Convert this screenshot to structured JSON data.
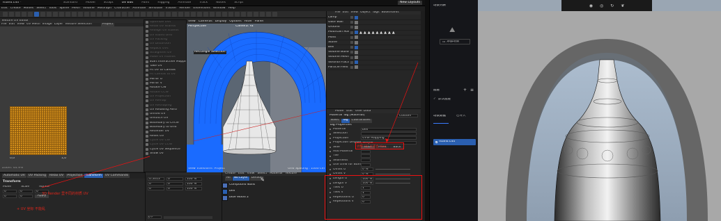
{
  "titlebar": {
    "file": "island.c4d *",
    "layouts": [
      "Standard",
      "Model",
      "Sculpt",
      "UV Edit",
      "Paint",
      "Rigging",
      "Animate",
      "Track",
      "Nodes",
      "Script"
    ],
    "new_layouts": "New Layouts"
  },
  "menubar": [
    "Edit",
    "Create",
    "Modes",
    "Select",
    "Tools",
    "Spline",
    "Mesh",
    "Volume",
    "MoGraph",
    "Character",
    "Animate",
    "Simulate",
    "Tracker",
    "Render",
    "Extensions",
    "Window",
    "Help"
  ],
  "uv_editor": {
    "title": "Texture UV Editor",
    "menus": [
      "File",
      "Edit",
      "View",
      "UV Mesh",
      "Image",
      "Layer",
      "Texture Selection"
    ],
    "project": "Project",
    "scale_label": "Zoom: 44.9%",
    "axis": [
      "0,0",
      "1,0"
    ]
  },
  "uv_menu": {
    "items": [
      "Optimize UVs",
      "Relax UV Islands",
      "Realign UV Islands",
      "UV Island Grid",
      "UV Packing",
      "UV Distortion",
      "Repack UVs",
      "Straighten UV",
      "Make UV Islands",
      "Start Interactive Mapping",
      "Take UV",
      "Fit UV to Canvas",
      "Fit Canvas to UV",
      "Mirror U",
      "Mirror V",
      "Rotate CW",
      "Rotate CCW",
      "UV Projection",
      "UV Remap",
      "UV Reshaping",
      "UV Relaxing Aero",
      "Unfold UV",
      "Unstitch UV",
      "Boundary to Circle",
      "Boundary to Grid",
      "Recenter UV",
      "Reset UV",
      "Cycle UV CW",
      "Cycle UV CCW",
      "Cycle UV Sequence",
      "Show UV"
    ],
    "dim_indices": [
      0,
      1,
      2,
      3,
      4,
      5,
      6,
      7,
      8,
      12,
      16,
      17,
      18,
      19,
      27,
      28
    ]
  },
  "viewport": {
    "menus": [
      "View",
      "Cameras",
      "Display",
      "Options",
      "Filter",
      "Panel"
    ],
    "title": "Perspective",
    "camera": "Camera: Fa",
    "selection": "Rectangle Selection",
    "footer_left": "View Transform: Project",
    "footer_right": "Grid Spacing : 1000 cm"
  },
  "object_manager": {
    "menus": [
      "File",
      "Edit",
      "View",
      "Object",
      "Tags",
      "Bookmarks"
    ],
    "rows": [
      "Lamp",
      "Gate Wall",
      "Ground",
      "Mountain Mask",
      "Moss",
      "Stone",
      "Bell",
      "Volume Builder",
      "Volume Mesher",
      "Voronoi Fracture",
      "Particle Field"
    ]
  },
  "attributes": {
    "menus": [
      "Mode",
      "Edit",
      "User Data"
    ],
    "tag": "Material Tag [Material]",
    "custom": "Custom",
    "tabs": [
      "Basic",
      "Tag",
      "Coordinates"
    ],
    "section": "Tag Properties",
    "props": [
      [
        "Material",
        "bell"
      ],
      [
        "Selection",
        ""
      ],
      [
        "Projection",
        "UVW Mapping"
      ],
      [
        "Projection Display",
        "Simple"
      ],
      [
        "Side",
        "Both"
      ],
      [
        "Add Material",
        ""
      ],
      [
        "Tile",
        ""
      ],
      [
        "Seamless",
        ""
      ],
      [
        "Use UVW for Bump",
        ""
      ],
      [
        "Offset U",
        "0 %"
      ],
      [
        "Offset V",
        "0 %"
      ],
      [
        "Length U",
        "100 %"
      ],
      [
        "Length V",
        "100 %"
      ],
      [
        "Tiles U",
        "1"
      ],
      [
        "Tiles V",
        "1"
      ],
      [
        "Repetitions U",
        "0"
      ],
      [
        "Repetitions V",
        "0"
      ]
    ],
    "side_opts": [
      "Both",
      "Front",
      "Back"
    ]
  },
  "bottom_left": {
    "tabs": [
      "Automatic UV",
      "UV Packing",
      "Relax UV",
      "Projection",
      "Transform",
      "UV Commands"
    ],
    "active_tab": "Transform",
    "section": "Transform",
    "labels": [
      "Move",
      "Scale",
      "Rotate"
    ],
    "values": [
      "0",
      "0",
      "0",
      "0",
      "0",
      "0 °"
    ],
    "apply": "Apply"
  },
  "timeline": {
    "rows": [
      [
        "0.5013",
        "0 °",
        "100 %"
      ],
      [
        "0",
        "0 °",
        "100 %"
      ],
      [
        "0",
        "0 °",
        "100 %"
      ]
    ],
    "frame": "0 F"
  },
  "material_mgr": {
    "menus": [
      "Create",
      "Edit",
      "View",
      "Select",
      "Material",
      "Texture"
    ],
    "tabs": [
      "All",
      "No Layer",
      "Default"
    ],
    "items": [
      "Compound walls",
      "bell",
      "blue Wood 2"
    ]
  },
  "annotations": {
    "left1": "3D Render 里不同的材质 UV",
    "left2": "+ UV 坐标 不能乱",
    "right": "调整 UV 以适合 tiles"
  },
  "side_panel": {
    "label1": "场景列表",
    "add": "添加场景",
    "reset": "重置默认",
    "section2": "图层",
    "item2": "默认图层",
    "section3": "场景数据",
    "tab3": "已导入",
    "file": "island.c4d"
  },
  "colors": {
    "accent": "#2a5fb0",
    "annot": "#e0261b",
    "uvgrid": "#d48f1a",
    "viewport_blue": "#1a6bff"
  }
}
